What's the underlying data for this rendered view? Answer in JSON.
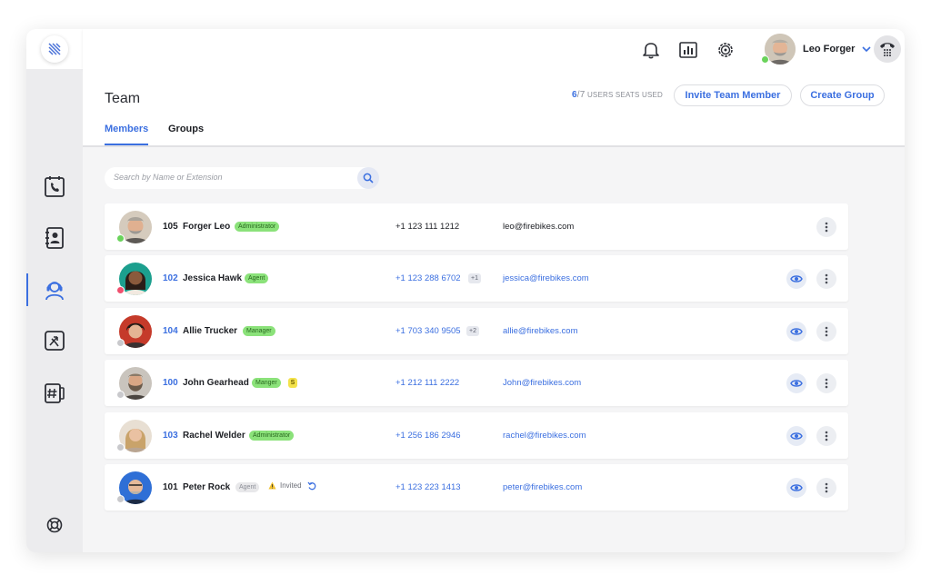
{
  "user": {
    "name": "Leo Forger"
  },
  "page": {
    "title": "Team"
  },
  "seats": {
    "used": "6",
    "total": "/7",
    "label": " USERS SEATS USED"
  },
  "actions": {
    "invite": "Invite Team Member",
    "create_group": "Create Group"
  },
  "tabs": {
    "members": "Members",
    "groups": "Groups"
  },
  "search": {
    "placeholder": "Search by Name or Extension"
  },
  "members": [
    {
      "ext": "105",
      "name": "Forger Leo",
      "role": "Administrator",
      "phone": "+1 123 111 1212",
      "email": "leo@firebikes.com",
      "presence_color": "#6ad35b"
    },
    {
      "ext": "102",
      "name": "Jessica Hawk",
      "role": "Agent",
      "phone": "+1 123 288 6702",
      "phone_more": "+1",
      "email": "jessica@firebikes.com",
      "presence_color": "#f0506e"
    },
    {
      "ext": "104",
      "name": "Allie Trucker",
      "role": "Manager",
      "phone": "+1 703 340 9505",
      "phone_more": "+2",
      "email": "allie@firebikes.com",
      "presence_color": "#c9c9cc"
    },
    {
      "ext": "100",
      "name": "John Gearhead",
      "role": "Manger",
      "extra_badge": "S",
      "phone": "+1 212 111 2222",
      "email": "John@firebikes.com",
      "presence_color": "#c9c9cc"
    },
    {
      "ext": "103",
      "name": "Rachel Welder",
      "role": "Administrator",
      "phone": "+1 256 186 2946",
      "email": "rachel@firebikes.com",
      "presence_color": "#c9c9cc"
    },
    {
      "ext": "101",
      "name": "Peter Rock",
      "role": "Agent",
      "status": "Invited",
      "phone": "+1 123 223 1413",
      "email": "peter@firebikes.com",
      "presence_color": "#c9c9cc"
    }
  ]
}
